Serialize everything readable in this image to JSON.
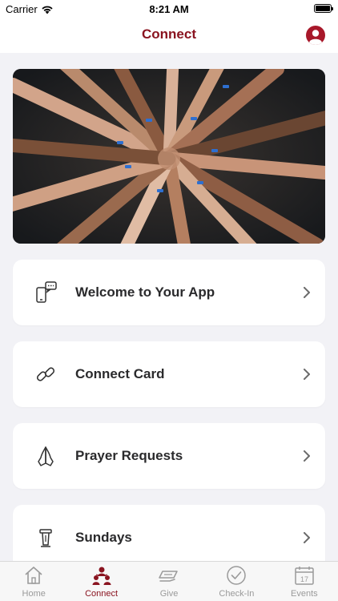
{
  "status_bar": {
    "carrier": "Carrier",
    "time": "8:21 AM"
  },
  "nav": {
    "title": "Connect",
    "profile_icon": "person-circle-icon"
  },
  "hero": {
    "description_icon": "hero-photo"
  },
  "cards": [
    {
      "label": "Welcome to Your App",
      "icon": "phone-chat-icon"
    },
    {
      "label": "Connect Card",
      "icon": "link-icon"
    },
    {
      "label": "Prayer Requests",
      "icon": "praying-hands-icon"
    },
    {
      "label": "Sundays",
      "icon": "podium-icon"
    }
  ],
  "tab_bar": {
    "items": [
      {
        "label": "Home",
        "icon": "home-icon",
        "active": false
      },
      {
        "label": "Connect",
        "icon": "people-icon",
        "active": true
      },
      {
        "label": "Give",
        "icon": "give-icon",
        "active": false
      },
      {
        "label": "Check-In",
        "icon": "check-circle-icon",
        "active": false
      },
      {
        "label": "Events",
        "icon": "calendar-icon",
        "active": false
      }
    ],
    "events_calendar_day": "17"
  },
  "colors": {
    "accent": "#8a1420",
    "profile": "#a8182a",
    "inactive": "#9a9a9a",
    "background": "#f2f2f6"
  }
}
